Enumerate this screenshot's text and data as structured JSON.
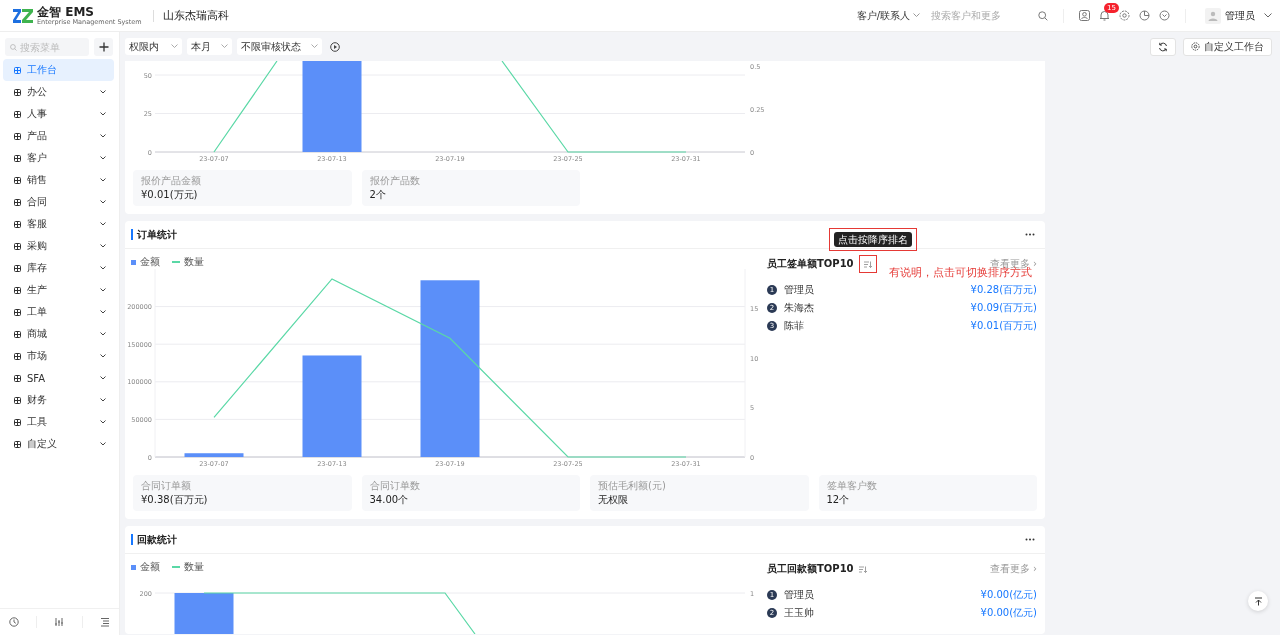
{
  "header": {
    "logo": {
      "mark": "金智",
      "name": "EMS",
      "tagline": "Enterprise Management System"
    },
    "company": "山东杰瑞高科",
    "search_scope": "客户/联系人",
    "search": {
      "placeholder": "搜索客户和更多"
    },
    "notification_count": "15",
    "user": "管理员"
  },
  "sidebar": {
    "search": {
      "placeholder": "搜索菜单"
    },
    "items": [
      {
        "label": "工作台",
        "selected": true,
        "expandable": false
      },
      {
        "label": "办公",
        "selected": false,
        "expandable": true
      },
      {
        "label": "人事",
        "selected": false,
        "expandable": true
      },
      {
        "label": "产品",
        "selected": false,
        "expandable": true
      },
      {
        "label": "客户",
        "selected": false,
        "expandable": true
      },
      {
        "label": "销售",
        "selected": false,
        "expandable": true
      },
      {
        "label": "合同",
        "selected": false,
        "expandable": true
      },
      {
        "label": "客服",
        "selected": false,
        "expandable": true
      },
      {
        "label": "采购",
        "selected": false,
        "expandable": true
      },
      {
        "label": "库存",
        "selected": false,
        "expandable": true
      },
      {
        "label": "生产",
        "selected": false,
        "expandable": true
      },
      {
        "label": "工单",
        "selected": false,
        "expandable": true
      },
      {
        "label": "商城",
        "selected": false,
        "expandable": true
      },
      {
        "label": "市场",
        "selected": false,
        "expandable": true
      },
      {
        "label": "SFA",
        "selected": false,
        "expandable": true
      },
      {
        "label": "财务",
        "selected": false,
        "expandable": true
      },
      {
        "label": "工具",
        "selected": false,
        "expandable": true
      },
      {
        "label": "自定义",
        "selected": false,
        "expandable": true
      }
    ]
  },
  "filters": [
    {
      "value": "权限内"
    },
    {
      "value": "本月"
    },
    {
      "value": "不限审核状态"
    }
  ],
  "customize_button": "自定义工作台",
  "sections": [
    {
      "kind": "partial",
      "chart_picture": {
        "y_labels": [
          "50",
          "25",
          "0"
        ],
        "y2_labels": [
          "0.5",
          "0.25",
          "0"
        ],
        "x_labels": [
          "23-07-07",
          "23-07-13",
          "23-07-19",
          "23-07-25",
          "23-07-31"
        ]
      },
      "stats": [
        {
          "label": "报价产品金额",
          "value": "¥0.01(万元)"
        },
        {
          "label": "报价产品数",
          "value": "2个"
        }
      ]
    },
    {
      "kind": "full",
      "title": "订单统计",
      "chart_data": {
        "type": "bar",
        "grid": true,
        "legend": "top-left",
        "categories": [
          "23-07-07",
          "23-07-13",
          "23-07-19",
          "23-07-25",
          "23-07-31"
        ],
        "ylim": [
          0,
          250000
        ],
        "yticks": [
          0,
          50000,
          100000,
          150000,
          200000
        ],
        "y2lim": [
          0,
          19
        ],
        "y2ticks": [
          0,
          5,
          10,
          15
        ],
        "series": [
          {
            "name": "金额",
            "type": "bar",
            "color": "#5b8ff9",
            "values": [
              5000,
              135000,
              235000,
              0,
              0
            ]
          },
          {
            "name": "数量",
            "type": "line",
            "axis": "y2",
            "color": "#5ad8a6",
            "values": [
              4,
              18,
              12,
              0,
              0
            ]
          }
        ]
      },
      "ranking": {
        "title": "员工签单额TOP10",
        "more": "查看更多 ›",
        "tooltip": "点击按降序排名",
        "note": "有说明，点击可切换排序方式",
        "items": [
          {
            "rank": "1",
            "name": "管理员",
            "value": "¥0.28(百万元)"
          },
          {
            "rank": "2",
            "name": "朱海杰",
            "value": "¥0.09(百万元)"
          },
          {
            "rank": "3",
            "name": "陈菲",
            "value": "¥0.01(百万元)"
          }
        ]
      },
      "stats": [
        {
          "label": "合同订单额",
          "value": "¥0.38(百万元)"
        },
        {
          "label": "合同订单数",
          "value": "34.00个"
        },
        {
          "label": "预估毛利额(元)",
          "value": "无权限"
        },
        {
          "label": "签单客户数",
          "value": "12个"
        }
      ]
    },
    {
      "kind": "full",
      "title": "回款统计",
      "chart_picture": {
        "legend": [
          {
            "name": "金额",
            "kind": "bar",
            "color": "#5b8ff9"
          },
          {
            "name": "数量",
            "kind": "line",
            "color": "#5ad8a6"
          }
        ],
        "y_labels": [
          "200"
        ],
        "y2_labels": [
          "1"
        ]
      },
      "ranking": {
        "title": "员工回款额TOP10",
        "more": "查看更多 ›",
        "items": [
          {
            "rank": "1",
            "name": "管理员",
            "value": "¥0.00(亿元)"
          },
          {
            "rank": "2",
            "name": "王玉帅",
            "value": "¥0.00(亿元)"
          }
        ]
      }
    }
  ]
}
